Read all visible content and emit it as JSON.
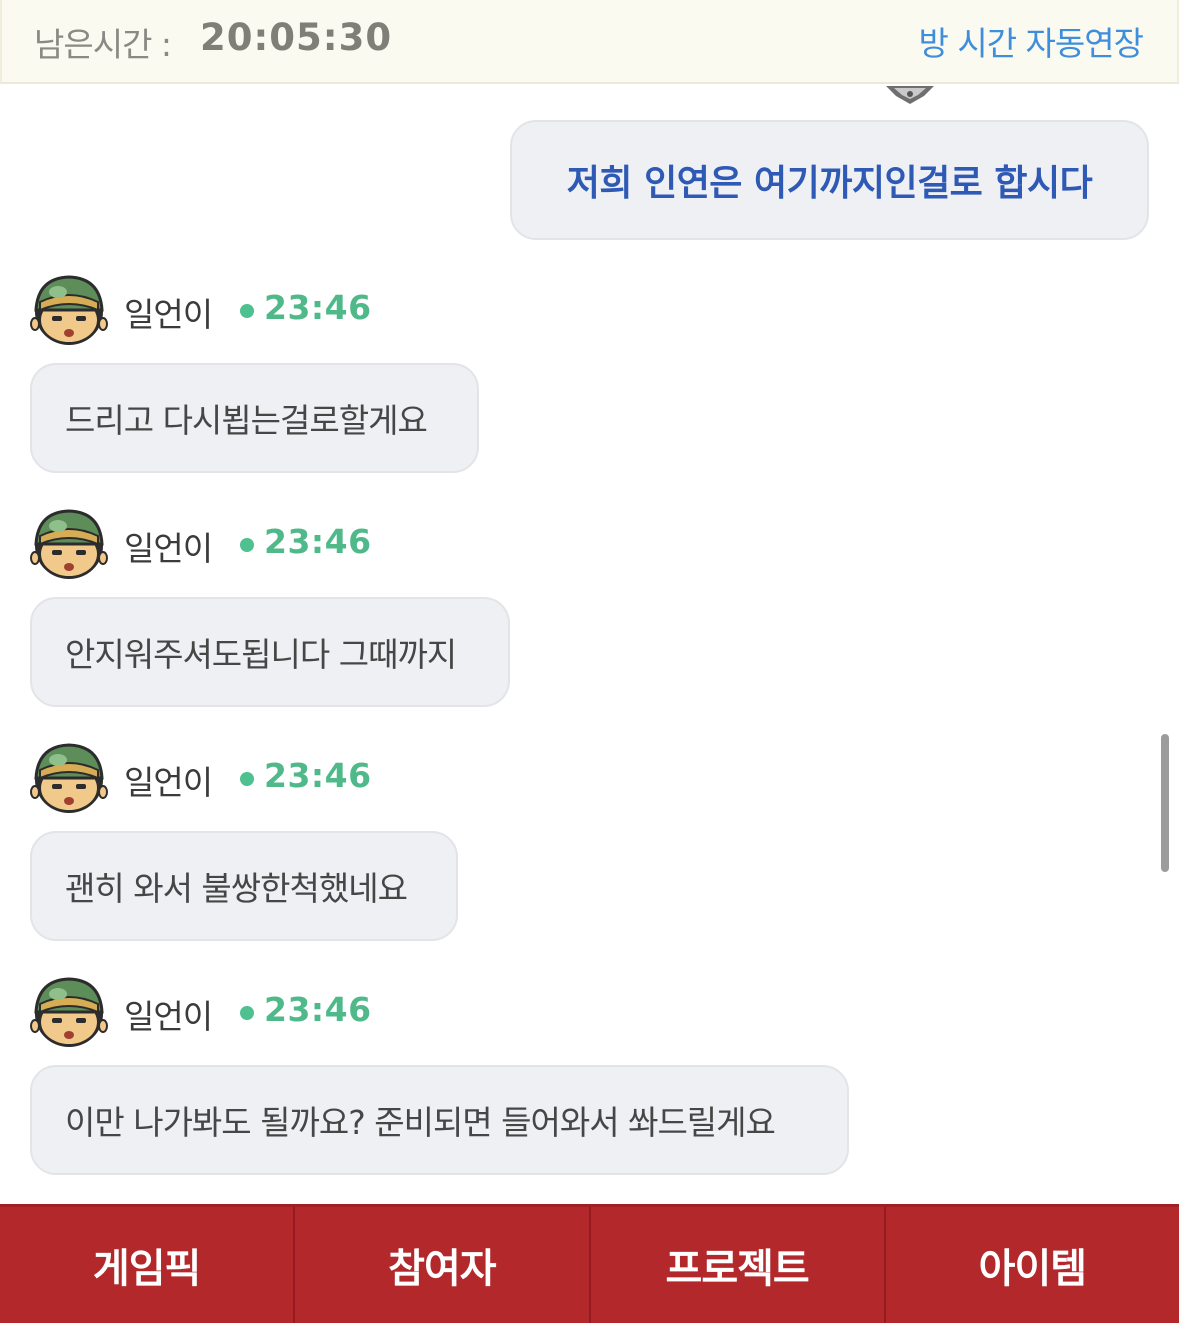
{
  "header": {
    "timer_label": "남은시간 :",
    "timer_value": "20:05:30",
    "extend_link": "방 시간 자동연장"
  },
  "my_message": {
    "text": "저희 인연은 여기까지인걸로 합시다"
  },
  "messages": [
    {
      "sender": "일언이",
      "time": "23:46",
      "text": "드리고 다시뵙는걸로할게요"
    },
    {
      "sender": "일언이",
      "time": "23:46",
      "text": "안지워주셔도됩니다 그때까지"
    },
    {
      "sender": "일언이",
      "time": "23:46",
      "text": "괜히 와서 불쌍한척했네요"
    },
    {
      "sender": "일언이",
      "time": "23:46",
      "text": "이만 나가봐도 될까요? 준비되면 들어와서 쏴드릴게요"
    }
  ],
  "bottom_nav": [
    "게임픽",
    "참여자",
    "프로젝트",
    "아이템"
  ],
  "colors": {
    "accent_link": "#3f8edc",
    "my_message_text": "#2e59b4",
    "online_dot": "#4fc08f",
    "bottom_nav_bg": "#b2282b"
  },
  "icons": {
    "avatar": "soldier-helmet-avatar-icon",
    "online_status": "online-dot-icon"
  }
}
